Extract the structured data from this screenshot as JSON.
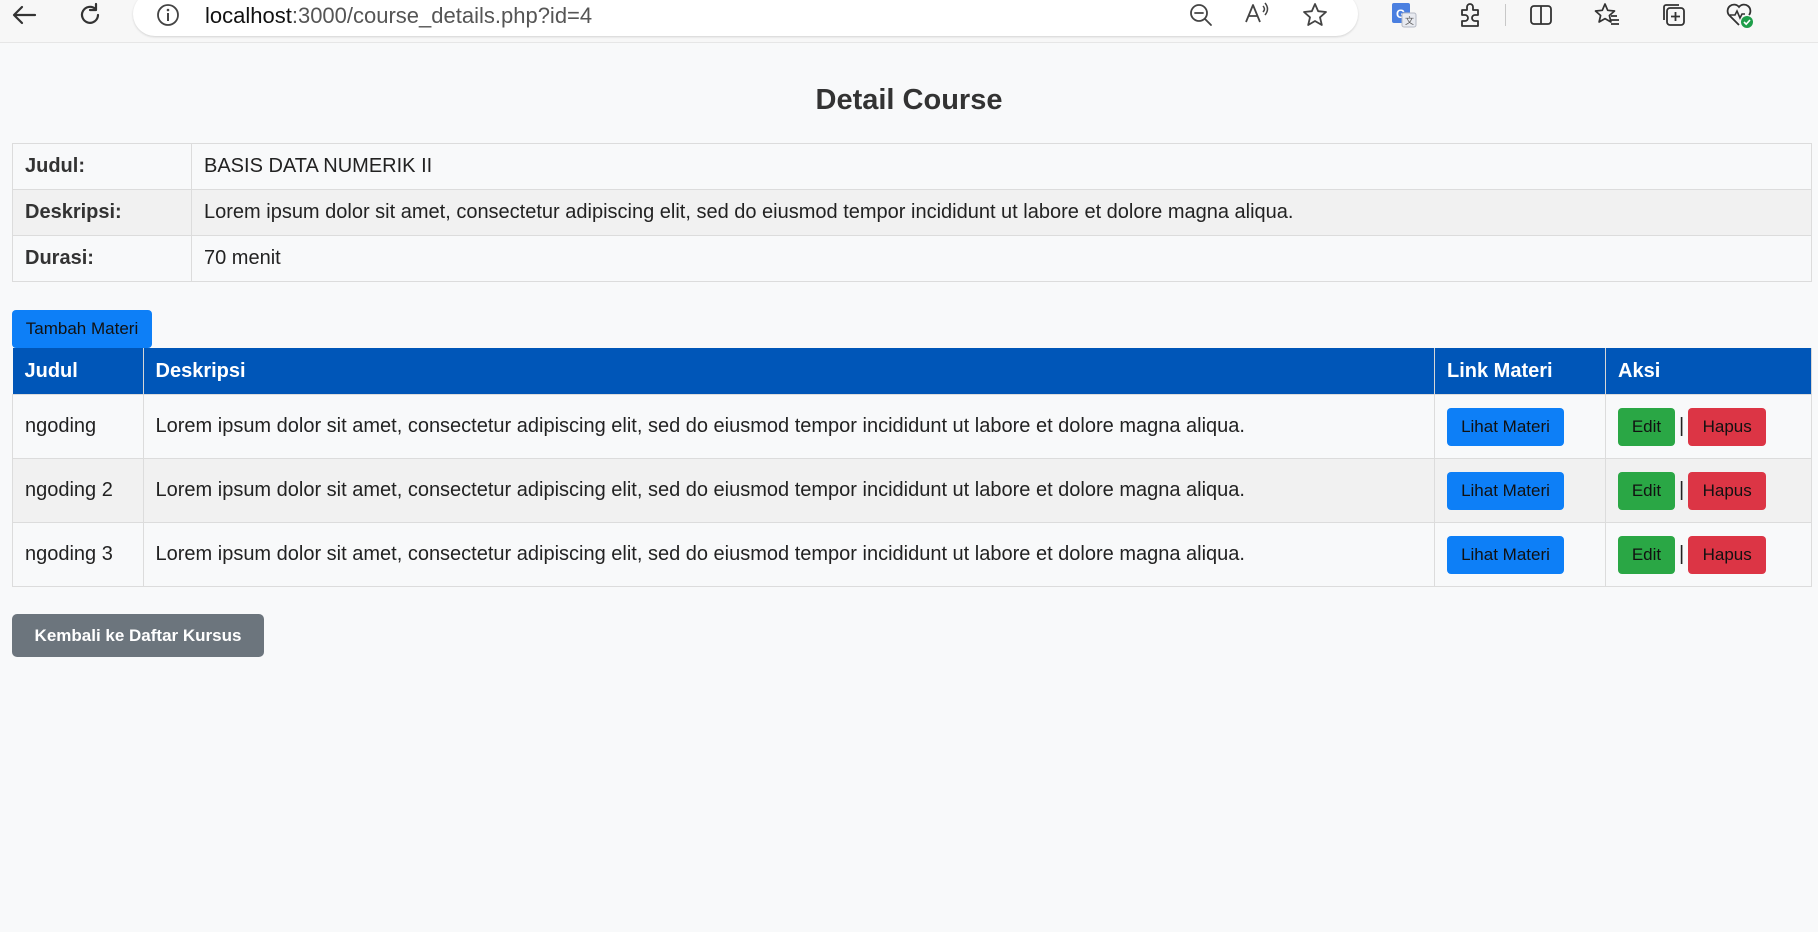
{
  "browser": {
    "url_host": "localhost",
    "url_rest": ":3000/course_details.php?id=4",
    "icons": [
      "back-arrow-icon",
      "refresh-icon",
      "info-icon",
      "zoom-out-icon",
      "read-aloud-icon",
      "favorite-star-icon",
      "translate-icon",
      "extensions-icon",
      "split-screen-icon",
      "favorites-icon",
      "collections-icon",
      "browser-health-icon"
    ]
  },
  "page": {
    "title": "Detail Course"
  },
  "course": {
    "rows": [
      {
        "label": "Judul:",
        "value": "BASIS DATA NUMERIK II"
      },
      {
        "label": "Deskripsi:",
        "value": "Lorem ipsum dolor sit amet, consectetur adipiscing elit, sed do eiusmod tempor incididunt ut labore et dolore magna aliqua."
      },
      {
        "label": "Durasi:",
        "value": "70 menit"
      }
    ]
  },
  "actions": {
    "add_label": "Tambah Materi",
    "back_label": "Kembali ke Daftar Kursus"
  },
  "materi": {
    "headers": [
      "Judul",
      "Deskripsi",
      "Link Materi",
      "Aksi"
    ],
    "rows": [
      {
        "judul": "ngoding",
        "deskripsi": "Lorem ipsum dolor sit amet, consectetur adipiscing elit, sed do eiusmod tempor incididunt ut labore et dolore magna aliqua.",
        "link_label": "Lihat Materi",
        "edit_label": "Edit",
        "separator": "|",
        "hapus_label": "Hapus"
      },
      {
        "judul": "ngoding 2",
        "deskripsi": "Lorem ipsum dolor sit amet, consectetur adipiscing elit, sed do eiusmod tempor incididunt ut labore et dolore magna aliqua.",
        "link_label": "Lihat Materi",
        "edit_label": "Edit",
        "separator": "|",
        "hapus_label": "Hapus"
      },
      {
        "judul": "ngoding 3",
        "deskripsi": "Lorem ipsum dolor sit amet, consectetur adipiscing elit, sed do eiusmod tempor incididunt ut labore et dolore magna aliqua.",
        "link_label": "Lihat Materi",
        "edit_label": "Edit",
        "separator": "|",
        "hapus_label": "Hapus"
      }
    ]
  },
  "colors": {
    "header_blue": "#0056b8",
    "primary": "#0d7ff7",
    "success": "#2aa745",
    "danger": "#dc3545",
    "secondary": "#6c757d"
  }
}
